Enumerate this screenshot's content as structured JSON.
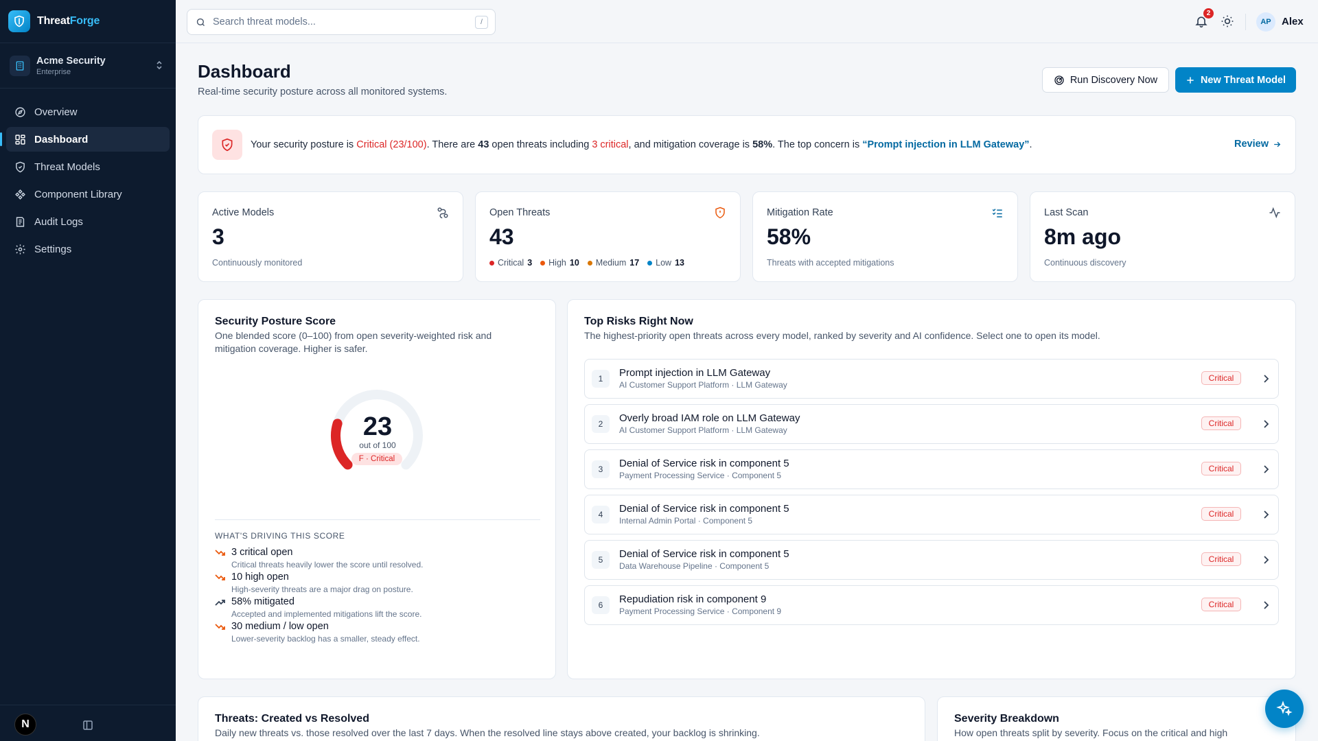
{
  "brand": {
    "name_part1": "Threat",
    "name_part2": "Forge"
  },
  "org": {
    "name": "Acme Security",
    "plan": "Enterprise"
  },
  "nav": [
    {
      "label": "Overview",
      "icon": "compass-icon",
      "active": false
    },
    {
      "label": "Dashboard",
      "icon": "grid-icon",
      "active": true
    },
    {
      "label": "Threat Models",
      "icon": "shield-icon",
      "active": false
    },
    {
      "label": "Component Library",
      "icon": "components-icon",
      "active": false
    },
    {
      "label": "Audit Logs",
      "icon": "log-icon",
      "active": false
    },
    {
      "label": "Settings",
      "icon": "gear-icon",
      "active": false
    }
  ],
  "footer": {
    "avatar_letter": "N"
  },
  "topbar": {
    "search_placeholder": "Search threat models...",
    "search_shortcut": "/",
    "notifications_count": "2",
    "user_initials": "AP",
    "user_name": "Alex"
  },
  "header": {
    "title": "Dashboard",
    "subtitle": "Real-time security posture across all monitored systems.",
    "run_discovery_label": "Run Discovery Now",
    "new_model_label": "New Threat Model"
  },
  "banner": {
    "t1": "Your security posture is ",
    "status": "Critical (23/100)",
    "t2": ". There are ",
    "open": "43",
    "t3": " open threats including ",
    "critical": "3 critical",
    "t4": ", and mitigation coverage is ",
    "coverage": "58%",
    "t5": ". The top concern is ",
    "concern": "“Prompt injection in LLM Gateway”",
    "t6": ".",
    "review_label": "Review"
  },
  "stats": [
    {
      "label": "Active Models",
      "value": "3",
      "foot": "Continuously monitored",
      "icon": "route-icon"
    },
    {
      "label": "Open Threats",
      "value": "43",
      "icon": "shield-alert-icon",
      "severity": [
        {
          "label": "Critical",
          "count": "3",
          "color": "#dc2626"
        },
        {
          "label": "High",
          "count": "10",
          "color": "#ea580c"
        },
        {
          "label": "Medium",
          "count": "17",
          "color": "#d97706"
        },
        {
          "label": "Low",
          "count": "13",
          "color": "#0284c7"
        }
      ]
    },
    {
      "label": "Mitigation Rate",
      "value": "58%",
      "foot": "Threats with accepted mitigations",
      "icon": "list-check-icon"
    },
    {
      "label": "Last Scan",
      "value": "8m ago",
      "foot": "Continuous discovery",
      "icon": "activity-icon"
    }
  ],
  "posture": {
    "title": "Security Posture Score",
    "desc1": "One blended score (0–100) from open severity-weighted risk and",
    "desc2": "mitigation coverage. Higher is safer.",
    "score": "23",
    "score_value": 23,
    "out_of": "out of 100",
    "grade": "F · Critical",
    "gauge_color": "#dc2626",
    "drivers_title": "WHAT'S DRIVING THIS SCORE",
    "drivers": [
      {
        "title": "3 critical open",
        "desc": "Critical threats heavily lower the score until resolved.",
        "icon": "trend-down-icon"
      },
      {
        "title": "10 high open",
        "desc": "High-severity threats are a major drag on posture.",
        "icon": "trend-down-icon"
      },
      {
        "title": "58% mitigated",
        "desc": "Accepted and implemented mitigations lift the score.",
        "icon": "trend-up-icon"
      },
      {
        "title": "30 medium / low open",
        "desc": "Lower-severity backlog has a smaller, steady effect.",
        "icon": "trend-down-icon"
      }
    ]
  },
  "risks": {
    "title": "Top Risks Right Now",
    "desc": "The highest-priority open threats across every model, ranked by severity and AI confidence. Select one to open its model.",
    "items": [
      {
        "rank": "1",
        "title": "Prompt injection in LLM Gateway",
        "sub": "AI Customer Support Platform · LLM Gateway",
        "severity": "Critical"
      },
      {
        "rank": "2",
        "title": "Overly broad IAM role on LLM Gateway",
        "sub": "AI Customer Support Platform · LLM Gateway",
        "severity": "Critical"
      },
      {
        "rank": "3",
        "title": "Denial of Service risk in component 5",
        "sub": "Payment Processing Service · Component 5",
        "severity": "Critical"
      },
      {
        "rank": "4",
        "title": "Denial of Service risk in component 5",
        "sub": "Internal Admin Portal · Component 5",
        "severity": "Critical"
      },
      {
        "rank": "5",
        "title": "Denial of Service risk in component 5",
        "sub": "Data Warehouse Pipeline · Component 5",
        "severity": "Critical"
      },
      {
        "rank": "6",
        "title": "Repudiation risk in component 9",
        "sub": "Payment Processing Service · Component 9",
        "severity": "Critical"
      }
    ]
  },
  "trend": {
    "title": "Threats: Created vs Resolved",
    "desc": "Daily new threats vs. those resolved over the last 7 days. When the resolved line stays above created, your backlog is shrinking."
  },
  "severity_breakdown": {
    "title": "Severity Breakdown",
    "desc": "How open threats split by severity. Focus on the critical and high"
  }
}
